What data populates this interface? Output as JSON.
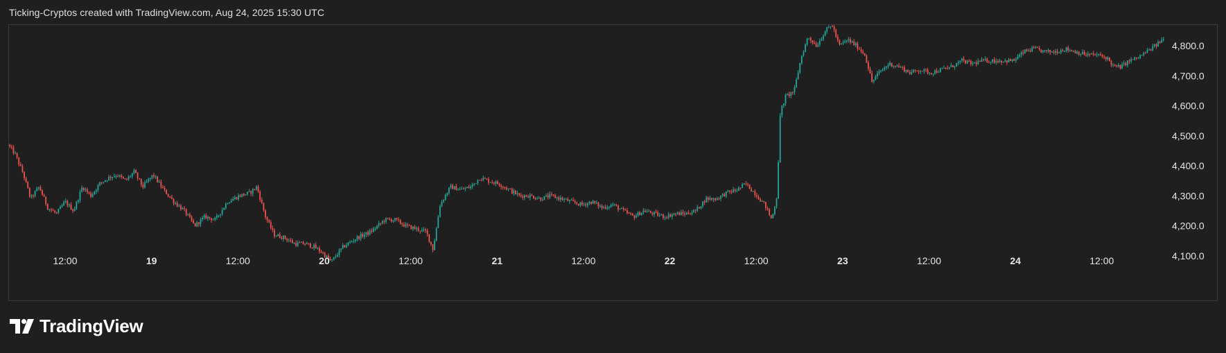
{
  "header": {
    "caption": "Ticking-Cryptos created with TradingView.com, Aug 24, 2025 15:30 UTC"
  },
  "brand": {
    "name": "TradingView",
    "logo_icon": "tradingview-logo-icon"
  },
  "colors": {
    "background": "#1f1f1f",
    "up": "#26a69a",
    "down": "#ef5350",
    "frame": "#3a3a3a",
    "text": "#e6e6e6"
  },
  "chart_data": {
    "type": "candlestick",
    "grid": false,
    "legend": "none",
    "ylim": [
      4050,
      4880
    ],
    "y_ticks": [
      "4,100.0",
      "4,200.0",
      "4,300.0",
      "4,400.0",
      "4,500.0",
      "4,600.0",
      "4,700.0",
      "4,800.0"
    ],
    "y_tick_values": [
      4100,
      4200,
      4300,
      4400,
      4500,
      4600,
      4700,
      4800
    ],
    "x_ticks": [
      {
        "label": "12:00",
        "day": 0.5,
        "bold": false
      },
      {
        "label": "19",
        "day": 1.0,
        "bold": true
      },
      {
        "label": "12:00",
        "day": 1.5,
        "bold": false
      },
      {
        "label": "20",
        "day": 2.0,
        "bold": true
      },
      {
        "label": "12:00",
        "day": 2.5,
        "bold": false
      },
      {
        "label": "21",
        "day": 3.0,
        "bold": true
      },
      {
        "label": "12:00",
        "day": 3.5,
        "bold": false
      },
      {
        "label": "22",
        "day": 4.0,
        "bold": true
      },
      {
        "label": "12:00",
        "day": 4.5,
        "bold": false
      },
      {
        "label": "23",
        "day": 5.0,
        "bold": true
      },
      {
        "label": "12:00",
        "day": 5.5,
        "bold": false
      },
      {
        "label": "24",
        "day": 6.0,
        "bold": true
      },
      {
        "label": "12:00",
        "day": 6.5,
        "bold": false
      }
    ],
    "x_range_days": [
      0.18,
      6.86
    ],
    "price_path": [
      [
        0.18,
        4470
      ],
      [
        0.22,
        4440
      ],
      [
        0.27,
        4370
      ],
      [
        0.31,
        4290
      ],
      [
        0.36,
        4330
      ],
      [
        0.41,
        4260
      ],
      [
        0.46,
        4240
      ],
      [
        0.51,
        4280
      ],
      [
        0.56,
        4250
      ],
      [
        0.61,
        4330
      ],
      [
        0.66,
        4300
      ],
      [
        0.71,
        4340
      ],
      [
        0.76,
        4360
      ],
      [
        0.81,
        4370
      ],
      [
        0.86,
        4350
      ],
      [
        0.91,
        4380
      ],
      [
        0.96,
        4330
      ],
      [
        1.02,
        4370
      ],
      [
        1.08,
        4320
      ],
      [
        1.14,
        4280
      ],
      [
        1.2,
        4250
      ],
      [
        1.26,
        4200
      ],
      [
        1.32,
        4230
      ],
      [
        1.38,
        4220
      ],
      [
        1.45,
        4280
      ],
      [
        1.52,
        4300
      ],
      [
        1.58,
        4310
      ],
      [
        1.62,
        4330
      ],
      [
        1.67,
        4230
      ],
      [
        1.72,
        4170
      ],
      [
        1.78,
        4160
      ],
      [
        1.84,
        4140
      ],
      [
        1.9,
        4140
      ],
      [
        1.95,
        4130
      ],
      [
        2.0,
        4110
      ],
      [
        2.05,
        4080
      ],
      [
        2.12,
        4130
      ],
      [
        2.2,
        4160
      ],
      [
        2.28,
        4180
      ],
      [
        2.36,
        4220
      ],
      [
        2.42,
        4220
      ],
      [
        2.48,
        4200
      ],
      [
        2.54,
        4190
      ],
      [
        2.6,
        4180
      ],
      [
        2.64,
        4120
      ],
      [
        2.68,
        4270
      ],
      [
        2.74,
        4330
      ],
      [
        2.8,
        4320
      ],
      [
        2.86,
        4330
      ],
      [
        2.91,
        4360
      ],
      [
        2.96,
        4350
      ],
      [
        3.02,
        4340
      ],
      [
        3.08,
        4320
      ],
      [
        3.14,
        4300
      ],
      [
        3.2,
        4300
      ],
      [
        3.26,
        4290
      ],
      [
        3.32,
        4300
      ],
      [
        3.38,
        4290
      ],
      [
        3.44,
        4280
      ],
      [
        3.5,
        4270
      ],
      [
        3.56,
        4280
      ],
      [
        3.62,
        4260
      ],
      [
        3.68,
        4270
      ],
      [
        3.74,
        4250
      ],
      [
        3.8,
        4230
      ],
      [
        3.86,
        4250
      ],
      [
        3.92,
        4240
      ],
      [
        3.98,
        4230
      ],
      [
        4.04,
        4240
      ],
      [
        4.1,
        4240
      ],
      [
        4.16,
        4250
      ],
      [
        4.22,
        4290
      ],
      [
        4.28,
        4290
      ],
      [
        4.34,
        4310
      ],
      [
        4.4,
        4320
      ],
      [
        4.45,
        4340
      ],
      [
        4.5,
        4310
      ],
      [
        4.56,
        4270
      ],
      [
        4.6,
        4220
      ],
      [
        4.63,
        4300
      ],
      [
        4.65,
        4580
      ],
      [
        4.68,
        4630
      ],
      [
        4.73,
        4650
      ],
      [
        4.77,
        4760
      ],
      [
        4.81,
        4830
      ],
      [
        4.86,
        4800
      ],
      [
        4.91,
        4850
      ],
      [
        4.95,
        4870
      ],
      [
        4.99,
        4800
      ],
      [
        5.04,
        4820
      ],
      [
        5.09,
        4800
      ],
      [
        5.14,
        4770
      ],
      [
        5.18,
        4680
      ],
      [
        5.22,
        4710
      ],
      [
        5.28,
        4740
      ],
      [
        5.34,
        4730
      ],
      [
        5.4,
        4710
      ],
      [
        5.46,
        4720
      ],
      [
        5.52,
        4710
      ],
      [
        5.58,
        4720
      ],
      [
        5.64,
        4730
      ],
      [
        5.7,
        4750
      ],
      [
        5.76,
        4740
      ],
      [
        5.82,
        4750
      ],
      [
        5.88,
        4750
      ],
      [
        5.94,
        4750
      ],
      [
        6.0,
        4750
      ],
      [
        6.06,
        4780
      ],
      [
        6.12,
        4790
      ],
      [
        6.18,
        4780
      ],
      [
        6.24,
        4780
      ],
      [
        6.3,
        4790
      ],
      [
        6.36,
        4780
      ],
      [
        6.42,
        4770
      ],
      [
        6.48,
        4770
      ],
      [
        6.54,
        4760
      ],
      [
        6.58,
        4730
      ],
      [
        6.62,
        4730
      ],
      [
        6.67,
        4750
      ],
      [
        6.72,
        4760
      ],
      [
        6.77,
        4780
      ],
      [
        6.82,
        4800
      ],
      [
        6.86,
        4820
      ]
    ]
  }
}
